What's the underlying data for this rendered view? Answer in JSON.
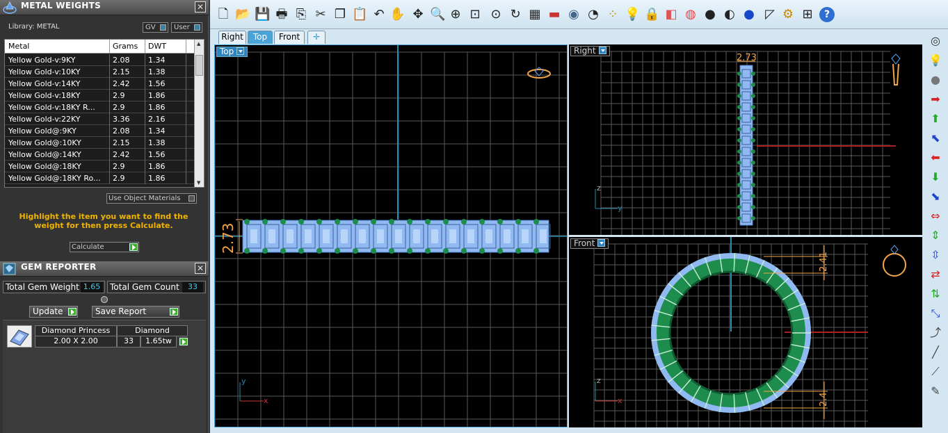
{
  "metal_panel": {
    "title": "METAL WEIGHTS",
    "library_label": "Library: METAL",
    "gv_button": "GV",
    "user_button": "User",
    "columns": [
      "Metal",
      "Grams",
      "DWT"
    ],
    "rows": [
      [
        "Yellow Gold-v:9KY",
        "2.08",
        "1.34"
      ],
      [
        "Yellow Gold-v:10KY",
        "2.15",
        "1.38"
      ],
      [
        "Yellow Gold-v:14KY",
        "2.42",
        "1.56"
      ],
      [
        "Yellow Gold-v:18KY",
        "2.9",
        "1.86"
      ],
      [
        "Yellow Gold-v:18KY R...",
        "2.9",
        "1.86"
      ],
      [
        "Yellow Gold-v:22KY",
        "3.36",
        "2.16"
      ],
      [
        "Yellow Gold@:9KY",
        "2.08",
        "1.34"
      ],
      [
        "Yellow Gold@:10KY",
        "2.15",
        "1.38"
      ],
      [
        "Yellow Gold@:14KY",
        "2.42",
        "1.56"
      ],
      [
        "Yellow Gold@:18KY",
        "2.9",
        "1.86"
      ],
      [
        "Yellow Gold@:18KY Ro...",
        "2.9",
        "1.86"
      ]
    ],
    "use_object_materials": "Use Object Materials",
    "hint": "Highlight the item you want to find the weight for then press Calculate.",
    "calculate_button": "Calculate"
  },
  "gem_panel": {
    "title": "GEM REPORTER",
    "total_weight_label": "Total Gem Weight",
    "total_weight_value": "1.65",
    "total_count_label": "Total Gem Count",
    "total_count_value": "33",
    "update_button": "Update",
    "save_report_button": "Save Report",
    "gem": {
      "name": "Diamond Princess",
      "type": "Diamond",
      "size": "2.00 X 2.00",
      "count": "33",
      "weight": "1.65tw"
    }
  },
  "view_tabs": [
    "Right",
    "Top",
    "Front"
  ],
  "active_tab": "Top",
  "add_tab_icon": "plus-icon",
  "viewports": {
    "top": {
      "label": "Top",
      "dimension": "2.73"
    },
    "right": {
      "label": "Right",
      "dimension": "2.73"
    },
    "front": {
      "label": "Front",
      "dimension_top": "2.41",
      "dimension_bottom": "2.4"
    }
  },
  "toolbar_icons": [
    "new-file-icon",
    "open-folder-icon",
    "save-icon",
    "print-icon",
    "export-icon",
    "cut-icon",
    "copy-icon",
    "paste-icon",
    "undo-icon",
    "pan-hand-icon",
    "move-icon",
    "zoom-icon",
    "zoom-window-icon",
    "zoom-extents-icon",
    "zoom-selected-icon",
    "rotate-view-icon",
    "grid-layout-icon",
    "car-icon",
    "eye-icon",
    "snap-icon",
    "object-snap-icon",
    "light-icon",
    "lock-icon",
    "layer-icon",
    "color-wheel-icon",
    "material-sphere-icon",
    "shaded-sphere-icon",
    "render-sphere-icon",
    "selection-icon",
    "settings-icon",
    "hierarchy-icon",
    "help-icon"
  ],
  "colors": {
    "accent": "#2f84c0",
    "grid": "#6e6e6e",
    "gem_blue": "#8fb9f0",
    "prong_green": "#1e8c4c",
    "dimension_orange": "#f4a64a",
    "hint_yellow": "#f0b400"
  }
}
